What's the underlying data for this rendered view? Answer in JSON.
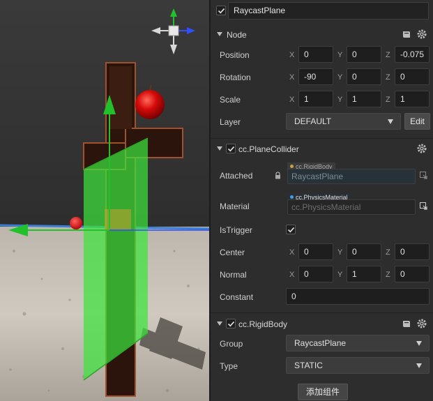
{
  "node": {
    "name": "RaycastPlane",
    "active": true
  },
  "node_section": {
    "title": "Node",
    "position": {
      "label": "Position",
      "x": "0",
      "y": "0",
      "z": "-0.075"
    },
    "rotation": {
      "label": "Rotation",
      "x": "-90",
      "y": "0",
      "z": "0"
    },
    "scale": {
      "label": "Scale",
      "x": "1",
      "y": "1",
      "z": "1"
    },
    "layer": {
      "label": "Layer",
      "value": "DEFAULT",
      "edit_label": "Edit"
    },
    "axis_labels": {
      "x": "X",
      "y": "Y",
      "z": "Z"
    }
  },
  "plane_collider": {
    "title": "cc.PlaneCollider",
    "enabled": true,
    "attached": {
      "label": "Attached",
      "tag": "cc.RigidBody",
      "value": "RaycastPlane"
    },
    "material": {
      "label": "Material",
      "tag": "cc.PhysicsMaterial",
      "value": "cc.PhysicsMaterial"
    },
    "is_trigger": {
      "label": "IsTrigger",
      "checked": true
    },
    "center": {
      "label": "Center",
      "x": "0",
      "y": "0",
      "z": "0"
    },
    "normal": {
      "label": "Normal",
      "x": "0",
      "y": "1",
      "z": "0"
    },
    "constant": {
      "label": "Constant",
      "value": "0"
    }
  },
  "rigid_body": {
    "title": "cc.RigidBody",
    "enabled": true,
    "group": {
      "label": "Group",
      "value": "RaycastPlane"
    },
    "type": {
      "label": "Type",
      "value": "STATIC"
    }
  },
  "add_component_label": "添加组件",
  "colors": {
    "panel_bg": "#2d2d2d",
    "field_bg": "#1e1e1e",
    "ground_line": "#3b7fd0",
    "gizmo_green": "#22c02a",
    "plane_green": "#3de33b",
    "apple_red": "#d60a0a"
  },
  "icons": [
    "checkbox-icon",
    "book-icon",
    "gear-icon",
    "lock-icon",
    "object-picker-icon",
    "view-cube-icon"
  ]
}
